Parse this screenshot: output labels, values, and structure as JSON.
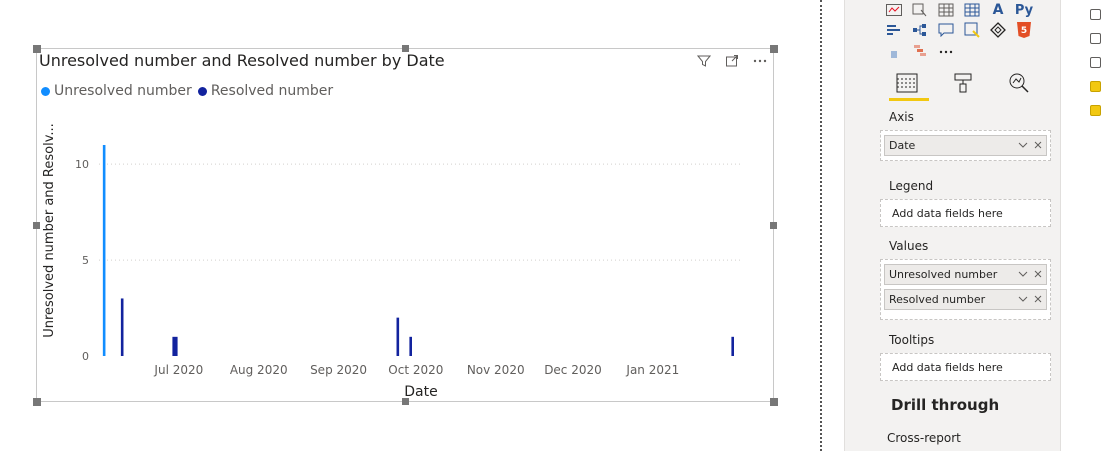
{
  "visual": {
    "title": "Unresolved number and Resolved number by Date",
    "icons": [
      "filter-icon",
      "focus-mode-icon",
      "more-options-icon"
    ]
  },
  "legend": [
    {
      "name": "Unresolved number",
      "color": "#118dff"
    },
    {
      "name": "Resolved number",
      "color": "#12239e"
    }
  ],
  "chart_data": {
    "type": "bar",
    "xlabel": "Date",
    "ylabel": "Unresolved number and Resolv...",
    "ylim": [
      0,
      11
    ],
    "yticks": [
      0,
      5,
      10
    ],
    "grid": true,
    "legend_position": "top-left",
    "xtick_labels": [
      "Jul 2020",
      "Aug 2020",
      "Sep 2020",
      "Oct 2020",
      "Nov 2020",
      "Dec 2020",
      "Jan 2021"
    ],
    "xtick_dates": [
      "2020-07-01",
      "2020-08-01",
      "2020-09-01",
      "2020-10-01",
      "2020-11-01",
      "2020-12-01",
      "2021-01-01"
    ],
    "x_range": [
      "2020-06-15",
      "2021-02-20"
    ],
    "series": [
      {
        "name": "Unresolved number",
        "color": "#118dff",
        "points": [
          {
            "x": "2020-06-17",
            "y": 11
          }
        ]
      },
      {
        "name": "Resolved number",
        "color": "#12239e",
        "points": [
          {
            "x": "2020-06-24",
            "y": 3
          },
          {
            "x": "2020-07-14",
            "y": 1
          },
          {
            "x": "2020-07-15",
            "y": 1
          },
          {
            "x": "2020-10-09",
            "y": 2
          },
          {
            "x": "2020-10-14",
            "y": 1
          },
          {
            "x": "2021-02-16",
            "y": 1
          }
        ]
      }
    ]
  },
  "pane": {
    "viz_row1": [
      "A",
      "Py"
    ],
    "tabs": [
      "fields-tab-icon",
      "format-tab-icon",
      "analytics-tab-icon"
    ],
    "axis_label": "Axis",
    "axis_field": "Date",
    "legend_label": "Legend",
    "legend_placeholder": "Add data fields here",
    "values_label": "Values",
    "values_fields": [
      "Unresolved number",
      "Resolved number"
    ],
    "tooltips_label": "Tooltips",
    "tooltips_placeholder": "Add data fields here",
    "drill_label": "Drill through",
    "cross_label": "Cross-report",
    "checkboxes": [
      false,
      false,
      false,
      true,
      true
    ]
  }
}
